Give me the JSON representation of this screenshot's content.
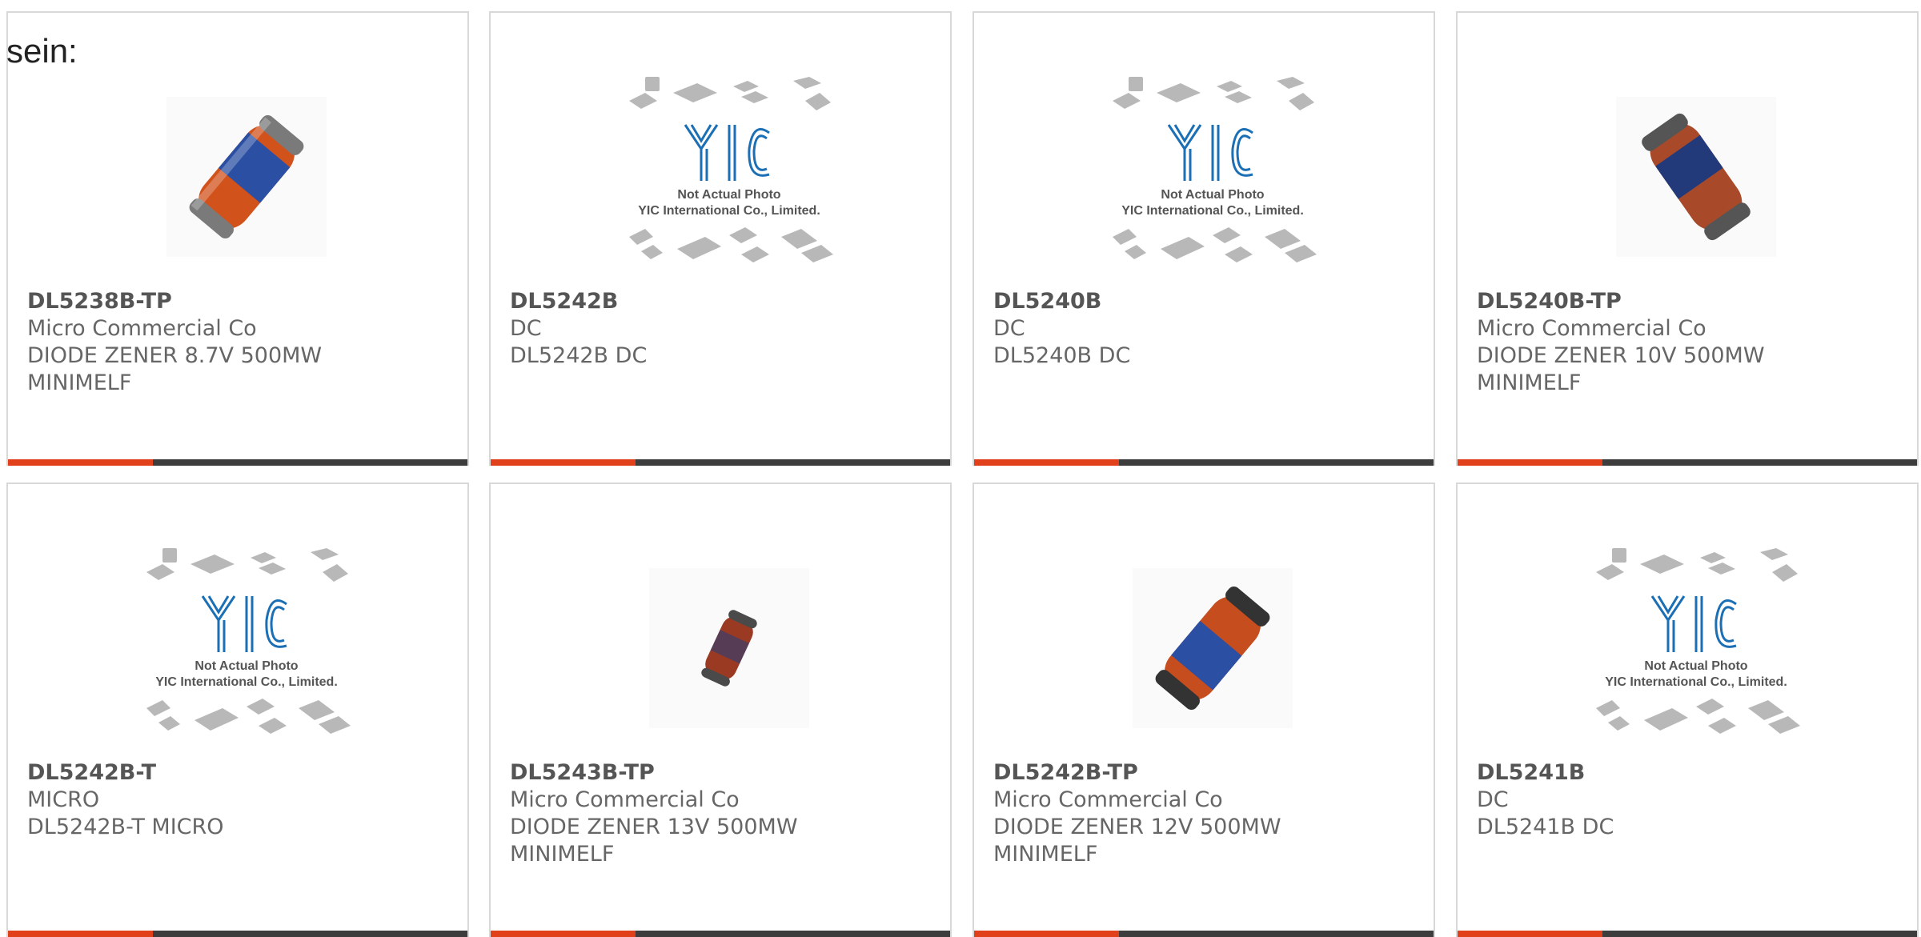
{
  "lead_text": "sein:",
  "colors": {
    "accent": "#e0411a",
    "bar_dark": "#3d3d3d",
    "border": "#d8d8d8",
    "yic_blue": "#1b6fb5"
  },
  "placeholder": {
    "line1": "Not Actual Photo",
    "line2": "YIC International Co., Limited."
  },
  "products": [
    {
      "part": "DL5238B-TP",
      "line1": "Micro Commercial Co",
      "line2": "DIODE ZENER 8.7V 500MW",
      "line3": "MINIMELF",
      "image": "diode-photo-large"
    },
    {
      "part": "DL5242B",
      "line1": "DC",
      "line2": "DL5242B DC",
      "line3": "",
      "image": "yic-placeholder"
    },
    {
      "part": "DL5240B",
      "line1": "DC",
      "line2": "DL5240B DC",
      "line3": "",
      "image": "yic-placeholder"
    },
    {
      "part": "DL5240B-TP",
      "line1": "Micro Commercial Co",
      "line2": "DIODE ZENER 10V 500MW",
      "line3": "MINIMELF",
      "image": "diode-photo-dark"
    },
    {
      "part": "DL5242B-T",
      "line1": "MICRO",
      "line2": "DL5242B-T MICRO",
      "line3": "",
      "image": "yic-placeholder"
    },
    {
      "part": "DL5243B-TP",
      "line1": "Micro Commercial Co",
      "line2": "DIODE ZENER 13V 500MW",
      "line3": "MINIMELF",
      "image": "diode-photo-small"
    },
    {
      "part": "DL5242B-TP",
      "line1": "Micro Commercial Co",
      "line2": "DIODE ZENER 12V 500MW",
      "line3": "MINIMELF",
      "image": "diode-photo-large"
    },
    {
      "part": "DL5241B",
      "line1": "DC",
      "line2": "DL5241B DC",
      "line3": "",
      "image": "yic-placeholder"
    }
  ]
}
